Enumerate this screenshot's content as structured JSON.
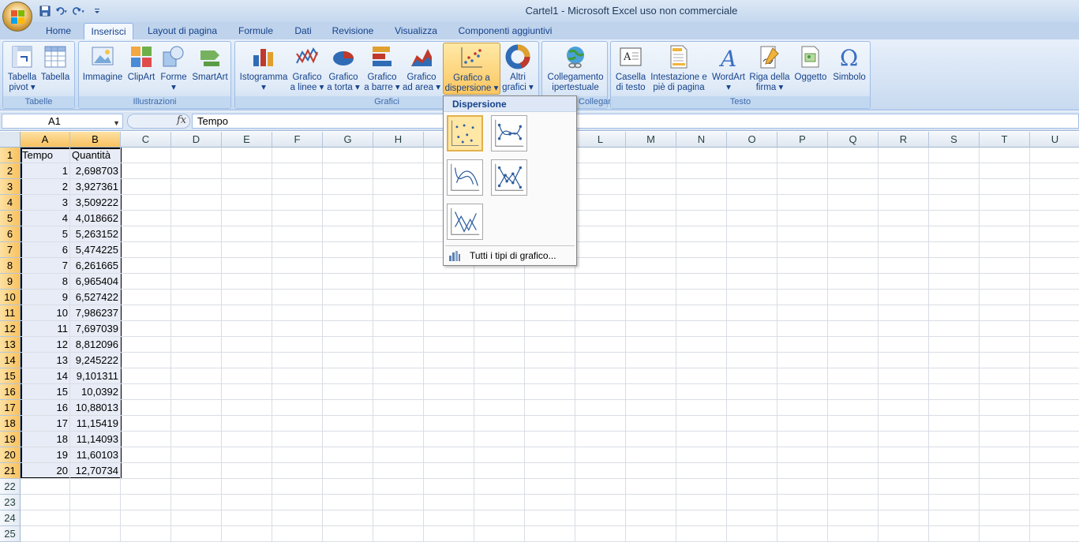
{
  "window": {
    "title": "Cartel1 - Microsoft Excel uso non commerciale"
  },
  "quick_access": {
    "icons": [
      "save-icon",
      "undo-icon",
      "redo-icon",
      "customize-icon"
    ]
  },
  "tabs": [
    "Home",
    "Inserisci",
    "Layout di pagina",
    "Formule",
    "Dati",
    "Revisione",
    "Visualizza",
    "Componenti aggiuntivi"
  ],
  "active_tab": "Inserisci",
  "ribbon": {
    "groups": {
      "tabelle": "Tabelle",
      "illustrazioni": "Illustrazioni",
      "grafici": "Grafici",
      "collegamenti": "Collegamenti",
      "testo": "Testo"
    },
    "buttons": {
      "tabella_pivot": [
        "Tabella",
        "pivot ▾"
      ],
      "tabella": [
        "Tabella",
        ""
      ],
      "immagine": [
        "Immagine",
        ""
      ],
      "clipart": [
        "ClipArt",
        ""
      ],
      "forme": [
        "Forme",
        "▾"
      ],
      "smartart": [
        "SmartArt",
        ""
      ],
      "istogramma": [
        "Istogramma",
        "▾"
      ],
      "linee": [
        "Grafico",
        "a linee ▾"
      ],
      "torta": [
        "Grafico",
        "a torta ▾"
      ],
      "barre": [
        "Grafico",
        "a barre ▾"
      ],
      "area": [
        "Grafico",
        "ad area ▾"
      ],
      "dispersione": [
        "Grafico a",
        "dispersione ▾"
      ],
      "altri": [
        "Altri",
        "grafici ▾"
      ],
      "collegamento": [
        "Collegamento",
        "ipertestuale"
      ],
      "casella": [
        "Casella",
        "di testo"
      ],
      "intestazione": [
        "Intestazione e",
        "piè di pagina"
      ],
      "wordart": [
        "WordArt",
        "▾"
      ],
      "riga_firma": [
        "Riga della",
        "firma ▾"
      ],
      "oggetto": [
        "Oggetto",
        ""
      ],
      "simbolo": [
        "Simbolo",
        ""
      ]
    }
  },
  "formula_bar": {
    "name_box": "A1",
    "fx": "fx",
    "content": "Tempo"
  },
  "columns": [
    "A",
    "B",
    "C",
    "D",
    "E",
    "F",
    "G",
    "H",
    "I",
    "J",
    "K",
    "L",
    "M",
    "N",
    "O",
    "P",
    "Q",
    "R",
    "S",
    "T",
    "U"
  ],
  "rows": [
    "1",
    "2",
    "3",
    "4",
    "5",
    "6",
    "7",
    "8",
    "9",
    "10",
    "11",
    "12",
    "13",
    "14",
    "15",
    "16",
    "17",
    "18",
    "19",
    "20",
    "21",
    "22",
    "23",
    "24",
    "25"
  ],
  "sheet": {
    "headers": [
      "Tempo",
      "Quantità"
    ],
    "tempo": [
      "1",
      "2",
      "3",
      "4",
      "5",
      "6",
      "7",
      "8",
      "9",
      "10",
      "11",
      "12",
      "13",
      "14",
      "15",
      "16",
      "17",
      "18",
      "19",
      "20"
    ],
    "quantita": [
      "2,698703",
      "3,927361",
      "3,509222",
      "4,018662",
      "5,263152",
      "5,474225",
      "6,261665",
      "6,965404",
      "6,527422",
      "7,986237",
      "7,697039",
      "8,812096",
      "9,245222",
      "9,101311",
      "10,0392",
      "10,88013",
      "11,15419",
      "11,14093",
      "11,60103",
      "12,70734"
    ]
  },
  "dropdown": {
    "header": "Dispersione",
    "items": [
      "scatter-markers-only",
      "scatter-smooth-lines-markers",
      "scatter-smooth-lines",
      "scatter-straight-lines-markers",
      "scatter-straight-lines"
    ],
    "all_types": "Tutti i tipi di grafico..."
  }
}
